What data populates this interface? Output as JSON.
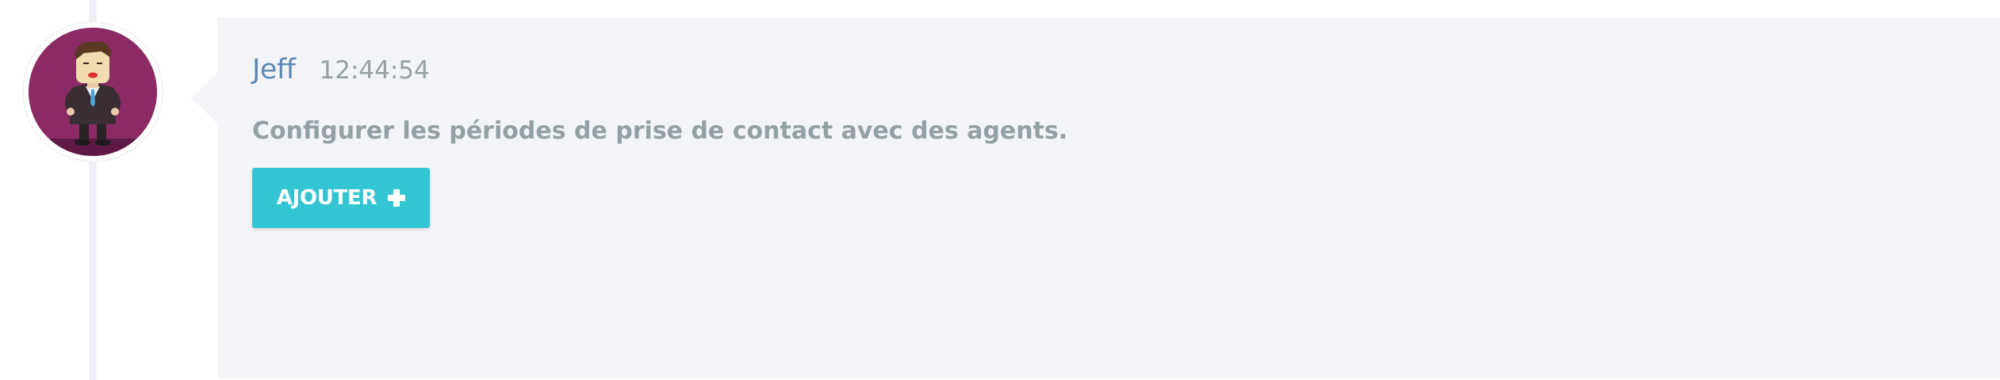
{
  "message": {
    "author": "Jeff",
    "time": "12:44:54",
    "text": "Configurer les périodes de prise de contact avec des agents.",
    "button_label": "AJOUTER",
    "button_icon": "plus-icon"
  },
  "avatar": {
    "icon": "businessman-avatar-icon",
    "background_color": "#8b2a64"
  },
  "colors": {
    "author": "#5b8ab5",
    "muted_text": "#93a0a4",
    "button": "#33c5d2",
    "bubble_background": "#f3f4f8"
  }
}
